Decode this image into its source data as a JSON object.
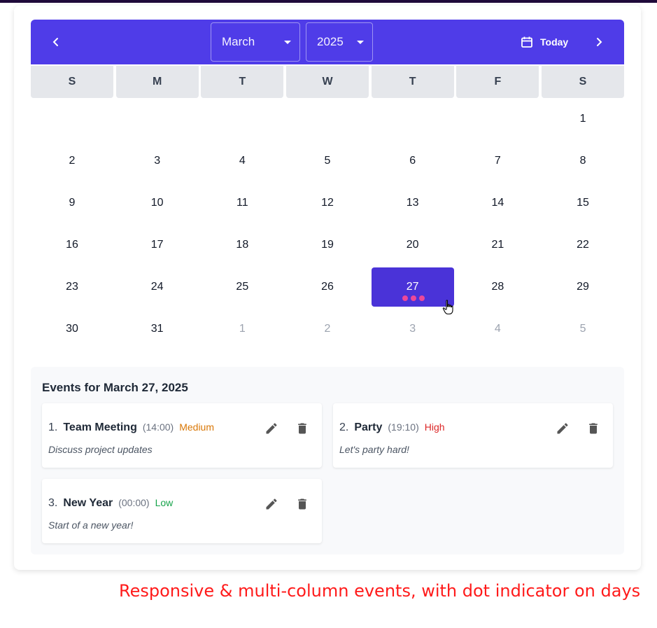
{
  "header": {
    "month": "March",
    "year": "2025",
    "today_label": "Today",
    "accent_color": "#4f3ce8"
  },
  "weekdays": [
    "S",
    "M",
    "T",
    "W",
    "T",
    "F",
    "S"
  ],
  "calendar": {
    "selected_day": "27",
    "selected_color": "#4a33d8",
    "event_dot_color": "#ec4899",
    "event_dot_count": 3,
    "weeks": [
      [
        {
          "d": "",
          "o": false
        },
        {
          "d": "",
          "o": false
        },
        {
          "d": "",
          "o": false
        },
        {
          "d": "",
          "o": false
        },
        {
          "d": "",
          "o": false
        },
        {
          "d": "",
          "o": false
        },
        {
          "d": "1",
          "o": false
        }
      ],
      [
        {
          "d": "2",
          "o": false
        },
        {
          "d": "3",
          "o": false
        },
        {
          "d": "4",
          "o": false
        },
        {
          "d": "5",
          "o": false
        },
        {
          "d": "6",
          "o": false
        },
        {
          "d": "7",
          "o": false
        },
        {
          "d": "8",
          "o": false
        }
      ],
      [
        {
          "d": "9",
          "o": false
        },
        {
          "d": "10",
          "o": false
        },
        {
          "d": "11",
          "o": false
        },
        {
          "d": "12",
          "o": false
        },
        {
          "d": "13",
          "o": false
        },
        {
          "d": "14",
          "o": false
        },
        {
          "d": "15",
          "o": false
        }
      ],
      [
        {
          "d": "16",
          "o": false
        },
        {
          "d": "17",
          "o": false
        },
        {
          "d": "18",
          "o": false
        },
        {
          "d": "19",
          "o": false
        },
        {
          "d": "20",
          "o": false
        },
        {
          "d": "21",
          "o": false
        },
        {
          "d": "22",
          "o": false
        }
      ],
      [
        {
          "d": "23",
          "o": false
        },
        {
          "d": "24",
          "o": false
        },
        {
          "d": "25",
          "o": false
        },
        {
          "d": "26",
          "o": false
        },
        {
          "d": "27",
          "o": false
        },
        {
          "d": "28",
          "o": false
        },
        {
          "d": "29",
          "o": false
        }
      ],
      [
        {
          "d": "30",
          "o": false
        },
        {
          "d": "31",
          "o": false
        },
        {
          "d": "1",
          "o": true
        },
        {
          "d": "2",
          "o": true
        },
        {
          "d": "3",
          "o": true
        },
        {
          "d": "4",
          "o": true
        },
        {
          "d": "5",
          "o": true
        }
      ]
    ]
  },
  "events": {
    "title": "Events for March 27, 2025",
    "items": [
      {
        "num": "1.",
        "name": "Team Meeting",
        "time": "(14:00)",
        "priority": "Medium",
        "priority_color": "#d97706",
        "description": "Discuss project updates"
      },
      {
        "num": "2.",
        "name": "Party",
        "time": "(19:10)",
        "priority": "High",
        "priority_color": "#dc2626",
        "description": "Let's party hard!"
      },
      {
        "num": "3.",
        "name": "New Year",
        "time": "(00:00)",
        "priority": "Low",
        "priority_color": "#16a34a",
        "description": "Start of a new year!"
      }
    ]
  },
  "caption": "Responsive & multi-column events, with dot indicator on days"
}
